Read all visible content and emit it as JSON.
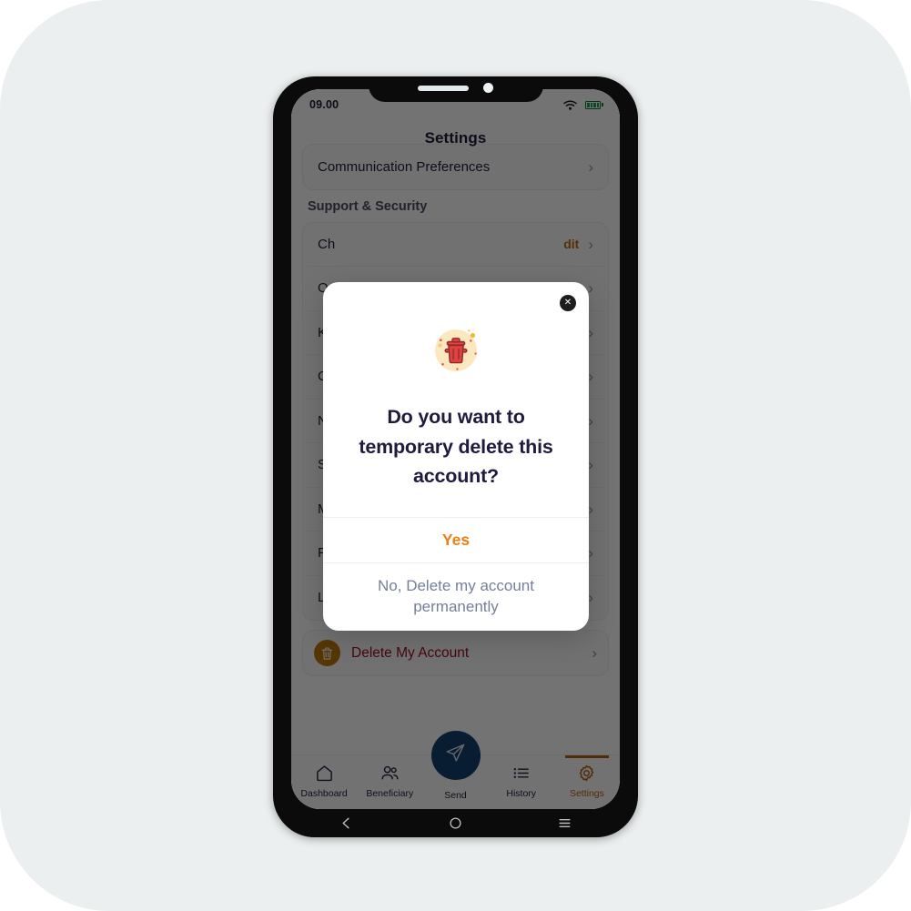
{
  "statusbar": {
    "time": "09.00",
    "wifi_icon": "wifi-icon",
    "battery_icon": "battery-icon"
  },
  "screen": {
    "title": "Settings"
  },
  "settings_list": {
    "partial_top_item": "Communication Preferences",
    "section_title": "Support & Security",
    "items": [
      {
        "label": "Ch",
        "trailing": "dit"
      },
      {
        "label": "Ou",
        "trailing": ""
      },
      {
        "label": "KY",
        "trailing": ""
      },
      {
        "label": "Co",
        "trailing": ""
      },
      {
        "label": "No",
        "trailing": ""
      },
      {
        "label": "Se",
        "trailing": ""
      },
      {
        "label": "Mo",
        "trailing": ""
      },
      {
        "label": "FA",
        "trailing": ""
      },
      {
        "label": "Logout",
        "trailing": ""
      }
    ],
    "chevron_icon": "chevron-right-icon"
  },
  "delete_account": {
    "label": "Delete My Account",
    "icon": "trash-icon",
    "chevron_icon": "chevron-right-icon",
    "icon_bg_color": "#c0790c",
    "text_color": "#9b1026"
  },
  "tabbar": {
    "items": [
      {
        "label": "Dashboard",
        "icon": "home-icon",
        "active": false
      },
      {
        "label": "Beneficiary",
        "icon": "people-icon",
        "active": false
      },
      {
        "label": "Send",
        "icon": "paper-plane-icon",
        "active": false
      },
      {
        "label": "History",
        "icon": "list-icon",
        "active": false
      },
      {
        "label": "Settings",
        "icon": "gear-icon",
        "active": true
      }
    ],
    "active_color": "#b4620a",
    "send_button_color": "#123f6e"
  },
  "modal": {
    "close_icon": "close-icon",
    "illustration_icon": "trash-can-illustration",
    "question": "Do you want to temporary delete this account?",
    "primary_label": "Yes",
    "secondary_label": "No, Delete my account permanently",
    "primary_color": "#f07e12",
    "secondary_color": "#74809a"
  },
  "system_nav": {
    "back_icon": "back-chevron-icon",
    "home_icon": "home-circle-icon",
    "recents_icon": "menu-icon"
  }
}
